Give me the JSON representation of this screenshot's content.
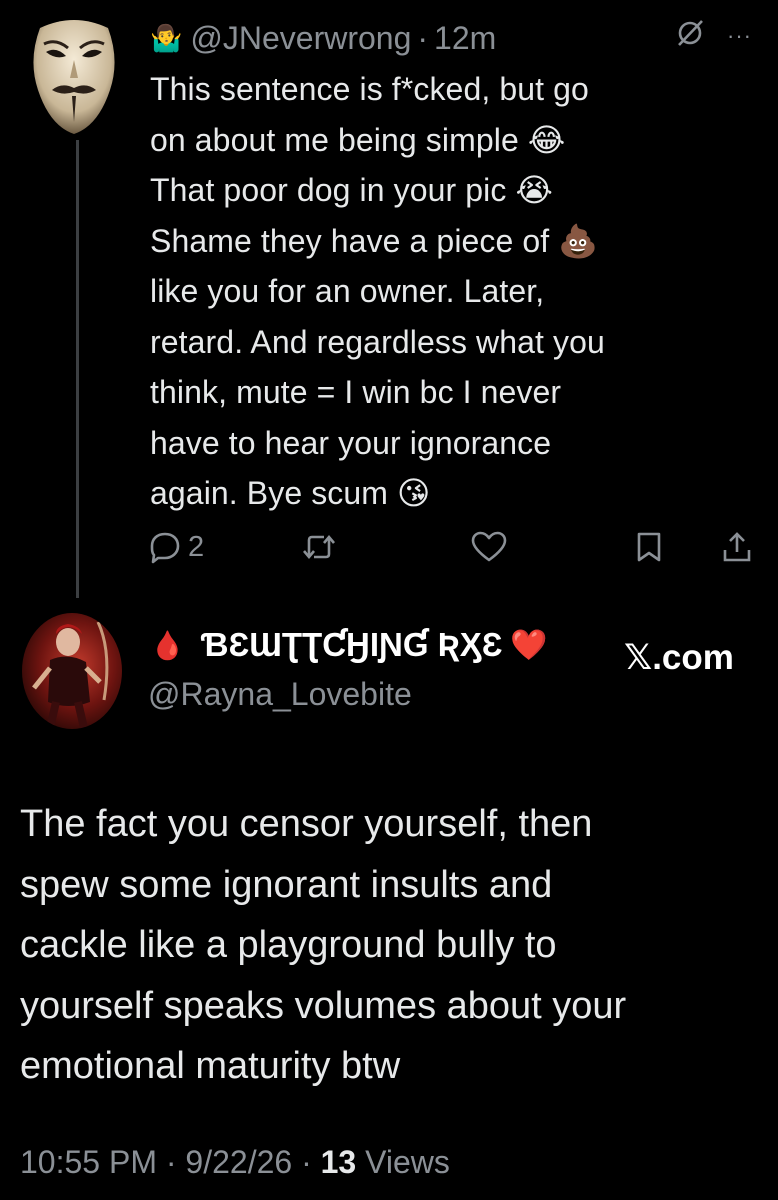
{
  "reply": {
    "shrug_emoji": "🤷‍♂️",
    "handle": "@JNeverwrong",
    "sep": "·",
    "time": "12m",
    "more": "···",
    "text": "This sentence is f*cked, but go\non about me being simple 😂\nThat poor dog in your pic 😭\nShame they have a piece of 💩\nlike you for an owner.  Later,\nretard.  And regardless what you\nthink, mute = I win bc I never\nhave to hear your ignorance\nagain.  Bye scum 😘",
    "reply_count": "2"
  },
  "post": {
    "drop": "🩸",
    "display_name": "ƁƐƜƮƮƇӇӀƝƓ ƦӼƐ",
    "heart": "❤️",
    "handle": "@Rayna_Lovebite",
    "xcom": "𝕏.com",
    "text": "The fact you censor yourself, then\nspew some ignorant insults and\ncackle like a playground bully to\nyourself speaks volumes about your\nemotional maturity btw",
    "time": "10:55 PM",
    "sep": "·",
    "date": "9/22/26",
    "sep2": "·",
    "views_count": "13",
    "views_label": "Views"
  },
  "colors": {
    "background": "#000000",
    "text": "#e7e9ea",
    "muted": "#8b9096",
    "thread_line": "#3c3f42"
  }
}
